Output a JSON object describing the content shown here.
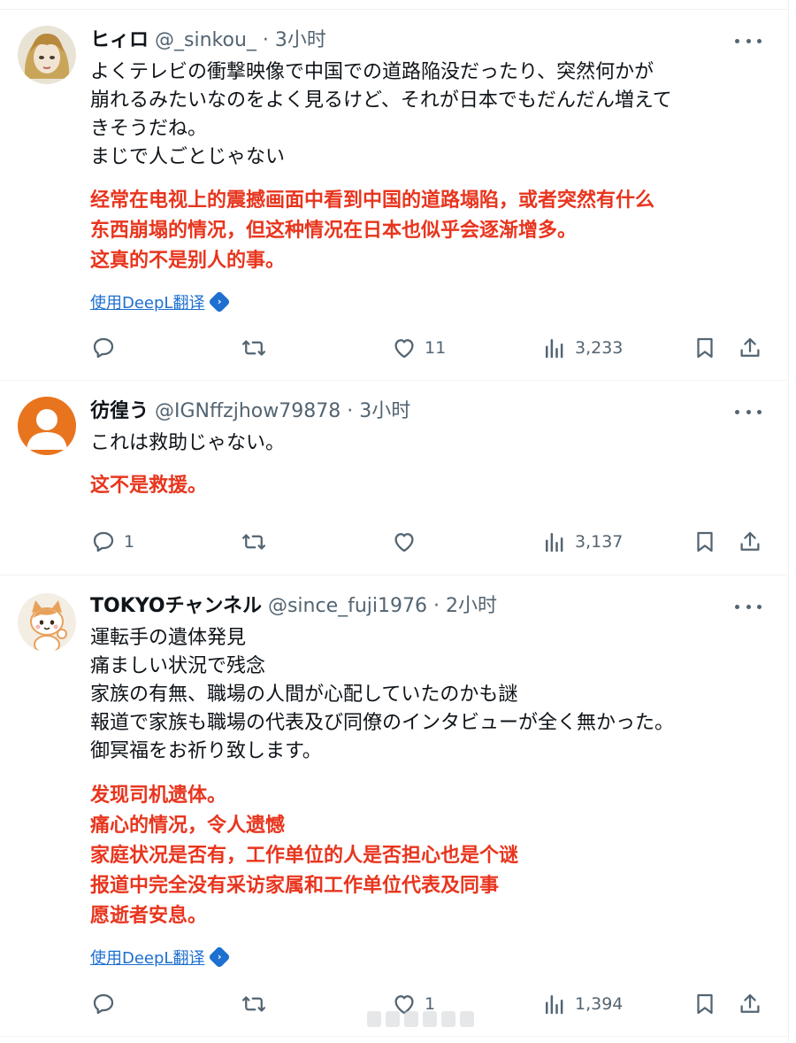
{
  "tweets": [
    {
      "name": "ヒィロ",
      "handle": "@_sinkou_",
      "dot": "·",
      "time": "3小时",
      "jp_lines": [
        "よくテレビの衝撃映像で中国での道路陥没だったり、突然何かが",
        "崩れるみたいなのをよく見るけど、それが日本でもだんだん増えて",
        "きそうだね。",
        "まじで人ごとじゃない"
      ],
      "cn_lines": [
        "经常在电视上的震撼画面中看到中国的道路塌陷，或者突然有什么",
        "东西崩塌的情况，但这种情况在日本也似乎会逐渐增多。",
        "这真的不是别人的事。"
      ],
      "translate_label": "使用DeepL翻译",
      "replies": "",
      "retweets": "",
      "likes": "11",
      "views": "3,233"
    },
    {
      "name": "彷徨う",
      "handle": "@IGNffzjhow79878",
      "dot": "·",
      "time": "3小时",
      "jp_lines": [
        "これは救助じゃない。"
      ],
      "cn_lines": [
        "这不是救援。"
      ],
      "replies": "1",
      "retweets": "",
      "likes": "",
      "views": "3,137"
    },
    {
      "name": "TOKYOチャンネル",
      "handle": "@since_fuji1976",
      "dot": "·",
      "time": "2小时",
      "jp_lines": [
        "運転手の遺体発見",
        "痛ましい状況で残念",
        "家族の有無、職場の人間が心配していたのかも謎",
        "報道で家族も職場の代表及び同僚のインタビューが全く無かった。",
        "御冥福をお祈り致します。"
      ],
      "cn_lines": [
        "发现司机遗体。",
        "痛心的情况，令人遗憾",
        "家庭状况是否有，工作单位的人是否担心也是个谜",
        "报道中完全没有采访家属和工作单位代表及同事",
        "愿逝者安息。"
      ],
      "translate_label": "使用DeepL翻译",
      "replies": "",
      "retweets": "",
      "likes": "1",
      "views": "1,394"
    }
  ],
  "icons": {
    "reply": "reply-icon",
    "retweet": "retweet-icon",
    "like": "heart-icon",
    "views": "views-icon",
    "bookmark": "bookmark-icon",
    "share": "share-icon",
    "more": "more-icon"
  },
  "colors": {
    "translation_red": "#e8351e",
    "link_blue": "#1d6fd0",
    "muted": "#536471"
  }
}
